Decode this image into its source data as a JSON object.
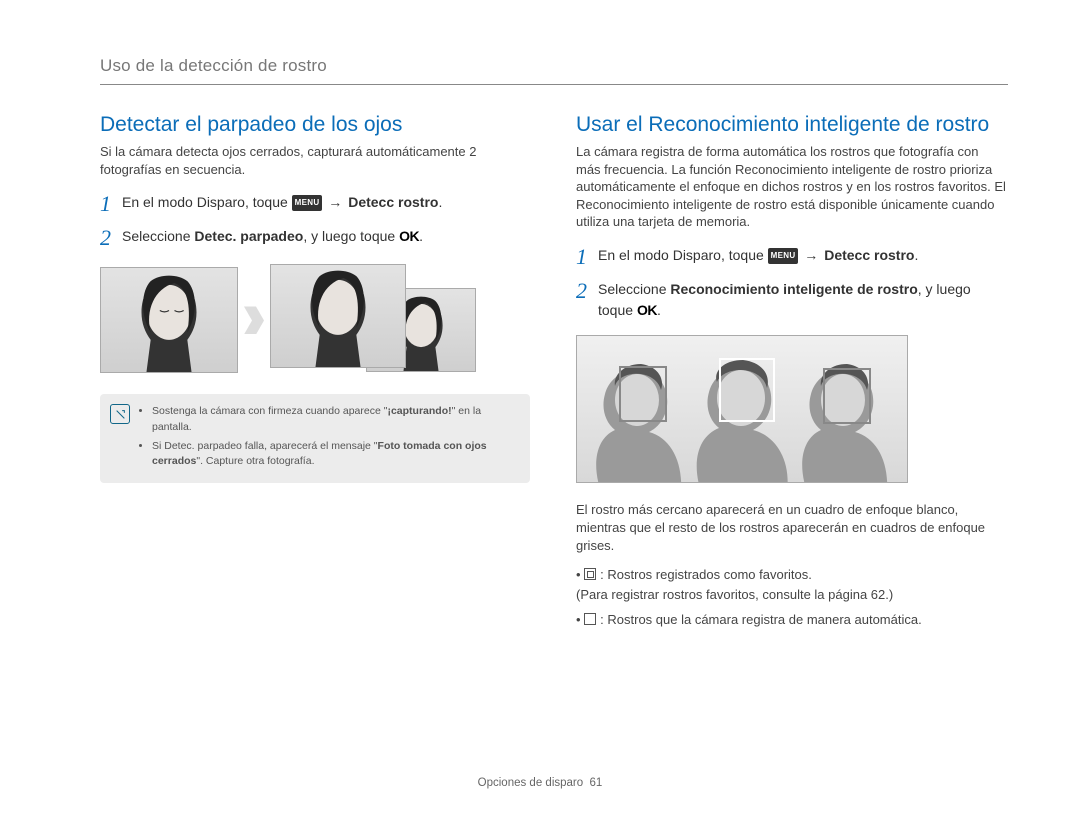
{
  "breadcrumb": "Uso de la detección de rostro",
  "left": {
    "title": "Detectar el parpadeo de los ojos",
    "intro": "Si la cámara detecta ojos cerrados, capturará automáticamente 2 fotografías en secuencia.",
    "steps": {
      "s1_a": "En el modo Disparo, toque ",
      "s1_menu": "MENU",
      "s1_b": " → ",
      "s1_bold": "Detecc rostro",
      "s1_c": ".",
      "s2_a": "Seleccione ",
      "s2_bold": "Detec. parpadeo",
      "s2_b": ", y luego toque ",
      "s2_ok": "OK",
      "s2_c": "."
    },
    "note": {
      "b1_a": "Sostenga la cámara con firmeza cuando aparece \"",
      "b1_bold": "¡capturando!",
      "b1_b": "\" en la pantalla.",
      "b2_a": "Si Detec. parpadeo falla, aparecerá el mensaje \"",
      "b2_bold": "Foto tomada con ojos cerrados",
      "b2_b": "\". Capture otra fotografía."
    }
  },
  "right": {
    "title": "Usar el Reconocimiento inteligente de rostro",
    "intro": "La cámara registra de forma automática los rostros que fotografía con más frecuencia. La función Reconocimiento inteligente de rostro prioriza automáticamente el enfoque en dichos rostros y en los rostros favoritos. El Reconocimiento inteligente de rostro está disponible únicamente cuando utiliza una tarjeta de memoria.",
    "steps": {
      "s1_a": "En el modo Disparo, toque ",
      "s1_menu": "MENU",
      "s1_b": " → ",
      "s1_bold": "Detecc rostro",
      "s1_c": ".",
      "s2_a": "Seleccione ",
      "s2_bold": "Reconocimiento inteligente de rostro",
      "s2_b": ", y luego toque ",
      "s2_ok": "OK",
      "s2_c": "."
    },
    "descr": "El rostro más cercano aparecerá en un cuadro de enfoque blanco, mientras que el resto de los rostros aparecerán en cuadros de enfoque grises.",
    "legend": {
      "l1_a": ": Rostros registrados como favoritos.",
      "l1_b": "(Para registrar rostros favoritos, consulte la página 62.)",
      "l2": ": Rostros que la cámara registra de manera automática."
    }
  },
  "footer": {
    "section": "Opciones de disparo",
    "page": "61"
  }
}
